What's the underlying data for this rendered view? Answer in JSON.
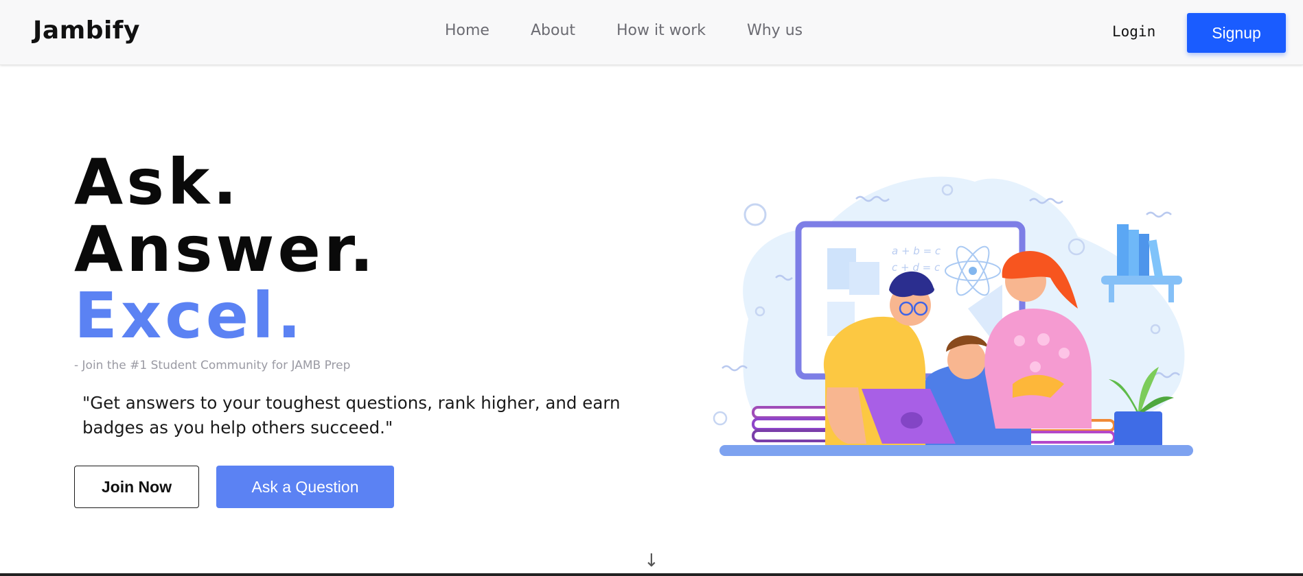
{
  "brand": "Jambify",
  "nav": {
    "links": [
      {
        "label": "Home"
      },
      {
        "label": "About"
      },
      {
        "label": "How it work"
      },
      {
        "label": "Why us"
      }
    ],
    "login": "Login",
    "signup": "Signup"
  },
  "hero": {
    "line1": "Ask.",
    "line2": "Answer.",
    "line3": "Excel.",
    "subtagline": "- Join the #1 Student Community for JAMB Prep",
    "quote": "\"Get answers to your toughest questions, rank higher, and earn badges as you help others succeed.\"",
    "join_button": "Join Now",
    "ask_button": "Ask a Question",
    "scroll_arrow": "↓"
  },
  "illustration": {
    "board_formulas": [
      "a + b = c",
      "c + d = c"
    ]
  },
  "colors": {
    "accent": "#5b82f3",
    "signup": "#1a5cff",
    "text": "#0a0a0a"
  }
}
